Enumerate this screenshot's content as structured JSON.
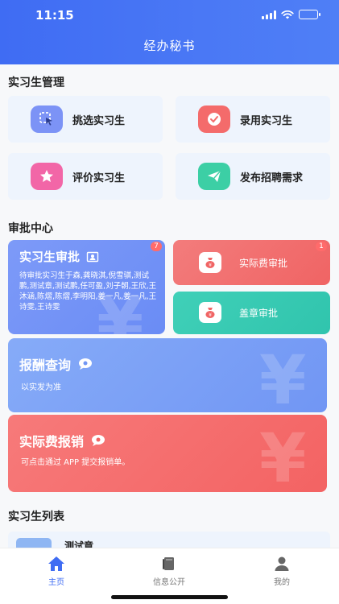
{
  "status_bar": {
    "time": "11:15"
  },
  "header": {
    "title": "经办秘书"
  },
  "intern_management": {
    "title": "实习生管理",
    "items": [
      {
        "label": "挑选实习生",
        "icon": "cursor-select-icon",
        "color": "#7c93f6"
      },
      {
        "label": "录用实习生",
        "icon": "check-circle-icon",
        "color": "#f46b6b"
      },
      {
        "label": "评价实习生",
        "icon": "star-icon",
        "color": "#f266a7"
      },
      {
        "label": "发布招聘需求",
        "icon": "paper-plane-icon",
        "color": "#3ccfa5"
      }
    ]
  },
  "approval_center": {
    "title": "审批中心",
    "intern_approval": {
      "title": "实习生审批",
      "badge": "7",
      "pending_text": "待审批实习生于森,龚晓淇,倪雪骐,测试鹏,测试章,测试鹏,任可盈,刘子朝,王欣,王沐涵,陈熠,陈熠,李明阳,姜一凡,姜一凡,王诗雯,王诗雯"
    },
    "actual_fee_approval": {
      "title": "实际费审批",
      "badge": "1"
    },
    "seal_approval": {
      "title": "盖章审批"
    },
    "remuneration_query": {
      "title": "报酬查询",
      "subtitle": "以实发为准"
    },
    "actual_fee_reimbursement": {
      "title": "实际费报销",
      "subtitle": "可点击通过 APP 提交报销单。"
    }
  },
  "intern_list": {
    "title": "实习生列表",
    "first_item_name": "测试章"
  },
  "bottom_nav": {
    "items": [
      {
        "label": "主页",
        "active": true
      },
      {
        "label": "信息公开",
        "active": false
      },
      {
        "label": "我的",
        "active": false
      }
    ]
  },
  "colors": {
    "primary": "#3f6cf3",
    "intern_card": "#6f8ff7",
    "fee_card": "#f26b6b",
    "seal_card": "#35c9b3",
    "query_card": "#7da4f7",
    "reimburse_card": "#f56a6a"
  }
}
